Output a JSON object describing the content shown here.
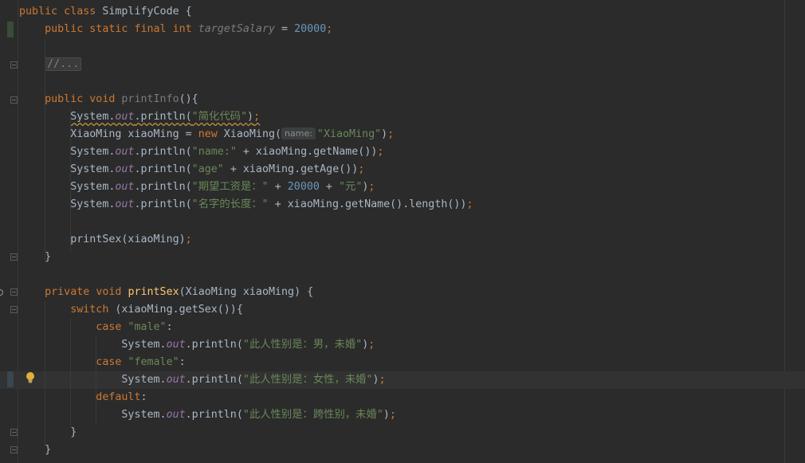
{
  "editor": {
    "lines": [
      {
        "id": "l1",
        "tokens": [
          [
            "kw",
            "public "
          ],
          [
            "kw",
            "class "
          ],
          [
            "cls",
            "SimplifyCode {"
          ]
        ]
      },
      {
        "id": "l2",
        "tokens": [
          [
            "sp",
            "    "
          ],
          [
            "kw",
            "public "
          ],
          [
            "kw",
            "static "
          ],
          [
            "kw",
            "final "
          ],
          [
            "kw",
            "int "
          ],
          [
            "unusedit",
            "targetSalary"
          ],
          [
            "cls",
            " = "
          ],
          [
            "num",
            "20000"
          ],
          [
            "kw",
            ";"
          ]
        ]
      },
      {
        "id": "l3",
        "tokens": []
      },
      {
        "id": "l4",
        "tokens": [
          [
            "sp",
            "    "
          ],
          [
            "fold",
            "//..."
          ]
        ]
      },
      {
        "id": "l5",
        "tokens": []
      },
      {
        "id": "l6",
        "tokens": [
          [
            "sp",
            "    "
          ],
          [
            "kw",
            "public "
          ],
          [
            "kw",
            "void "
          ],
          [
            "unused",
            "printInfo"
          ],
          [
            "cls",
            "(){"
          ]
        ]
      },
      {
        "id": "l7",
        "tokens": [
          [
            "sp",
            "        "
          ],
          [
            "squig",
            "System."
          ],
          [
            "squigfield",
            "out"
          ],
          [
            "squig",
            ".println("
          ],
          [
            "squigstr",
            "\"简化代码\""
          ],
          [
            "squig",
            ")"
          ],
          [
            "squigkw",
            ";"
          ]
        ]
      },
      {
        "id": "l8",
        "tokens": [
          [
            "sp",
            "        "
          ],
          [
            "cls",
            "XiaoMing xiaoMing = "
          ],
          [
            "kw",
            "new "
          ],
          [
            "cls",
            "XiaoMing("
          ],
          [
            "hint",
            "name:"
          ],
          [
            "str",
            "\"XiaoMing\""
          ],
          [
            "cls",
            ")"
          ],
          [
            "kw",
            ";"
          ]
        ]
      },
      {
        "id": "l9",
        "tokens": [
          [
            "sp",
            "        "
          ],
          [
            "cls",
            "System."
          ],
          [
            "field",
            "out"
          ],
          [
            "cls",
            ".println("
          ],
          [
            "str",
            "\"name:\""
          ],
          [
            "cls",
            " + xiaoMing.getName())"
          ],
          [
            "kw",
            ";"
          ]
        ]
      },
      {
        "id": "l10",
        "tokens": [
          [
            "sp",
            "        "
          ],
          [
            "cls",
            "System."
          ],
          [
            "field",
            "out"
          ],
          [
            "cls",
            ".println("
          ],
          [
            "str",
            "\"age\""
          ],
          [
            "cls",
            " + xiaoMing.getAge())"
          ],
          [
            "kw",
            ";"
          ]
        ]
      },
      {
        "id": "l11",
        "tokens": [
          [
            "sp",
            "        "
          ],
          [
            "cls",
            "System."
          ],
          [
            "field",
            "out"
          ],
          [
            "cls",
            ".println("
          ],
          [
            "str",
            "\"期望工资是：\""
          ],
          [
            "cls",
            " + "
          ],
          [
            "num",
            "20000"
          ],
          [
            "cls",
            " + "
          ],
          [
            "str",
            "\"元\""
          ],
          [
            "cls",
            ")"
          ],
          [
            "kw",
            ";"
          ]
        ]
      },
      {
        "id": "l12",
        "tokens": [
          [
            "sp",
            "        "
          ],
          [
            "cls",
            "System."
          ],
          [
            "field",
            "out"
          ],
          [
            "cls",
            ".println("
          ],
          [
            "str",
            "\"名字的长度：\""
          ],
          [
            "cls",
            " + xiaoMing.getName().length())"
          ],
          [
            "kw",
            ";"
          ]
        ]
      },
      {
        "id": "l13",
        "tokens": []
      },
      {
        "id": "l14",
        "tokens": [
          [
            "sp",
            "        "
          ],
          [
            "cls",
            "printSex(xiaoMing)"
          ],
          [
            "kw",
            ";"
          ]
        ]
      },
      {
        "id": "l15",
        "tokens": [
          [
            "sp",
            "    "
          ],
          [
            "cls",
            "}"
          ]
        ]
      },
      {
        "id": "l16",
        "tokens": []
      },
      {
        "id": "l17",
        "tokens": [
          [
            "sp",
            "    "
          ],
          [
            "kw",
            "private "
          ],
          [
            "kw",
            "void "
          ],
          [
            "mdecl",
            "printSex"
          ],
          [
            "cls",
            "(XiaoMing xiaoMing) {"
          ]
        ]
      },
      {
        "id": "l18",
        "tokens": [
          [
            "sp",
            "        "
          ],
          [
            "kw",
            "switch "
          ],
          [
            "cls",
            "(xiaoMing.getSex()){"
          ]
        ]
      },
      {
        "id": "l19",
        "tokens": [
          [
            "sp",
            "            "
          ],
          [
            "kw",
            "case "
          ],
          [
            "str",
            "\"male\""
          ],
          [
            "cls",
            ":"
          ]
        ]
      },
      {
        "id": "l20",
        "tokens": [
          [
            "sp",
            "                "
          ],
          [
            "cls",
            "System."
          ],
          [
            "field",
            "out"
          ],
          [
            "cls",
            ".println("
          ],
          [
            "str",
            "\"此人性别是：男，未婚\""
          ],
          [
            "cls",
            ")"
          ],
          [
            "kw",
            ";"
          ]
        ]
      },
      {
        "id": "l21",
        "tokens": [
          [
            "sp",
            "            "
          ],
          [
            "kw",
            "case "
          ],
          [
            "str",
            "\"female\""
          ],
          [
            "cls",
            ":"
          ]
        ]
      },
      {
        "id": "l22",
        "tokens": [
          [
            "sp",
            "                "
          ],
          [
            "cls",
            "System."
          ],
          [
            "field",
            "out"
          ],
          [
            "cls",
            ".println("
          ],
          [
            "str",
            "\"此人性别是：女性，未婚\""
          ],
          [
            "cls",
            ")"
          ],
          [
            "kw",
            ";"
          ]
        ]
      },
      {
        "id": "l23",
        "tokens": [
          [
            "sp",
            "            "
          ],
          [
            "kw",
            "default"
          ],
          [
            "cls",
            ":"
          ]
        ]
      },
      {
        "id": "l24",
        "tokens": [
          [
            "sp",
            "                "
          ],
          [
            "cls",
            "System."
          ],
          [
            "field",
            "out"
          ],
          [
            "cls",
            ".println("
          ],
          [
            "str",
            "\"此人性别是：跨性别，未婚\""
          ],
          [
            "cls",
            ")"
          ],
          [
            "kw",
            ";"
          ]
        ]
      },
      {
        "id": "l25",
        "tokens": [
          [
            "sp",
            "        "
          ],
          [
            "cls",
            "}"
          ]
        ]
      },
      {
        "id": "l26",
        "tokens": [
          [
            "sp",
            "    "
          ],
          [
            "cls",
            "}"
          ]
        ]
      }
    ],
    "current_line": "l22",
    "colors": {
      "background": "#2b2b2b",
      "keyword": "#cc7832",
      "string": "#6a8759",
      "number": "#6897bb",
      "field": "#9876aa",
      "method_declaration": "#ffc66d",
      "default_text": "#a9b7c6",
      "unused": "#7a7a7a"
    },
    "gutter_icons": [
      "fold-marker-icon",
      "lightbulb-icon",
      "change-marker-icon"
    ]
  }
}
